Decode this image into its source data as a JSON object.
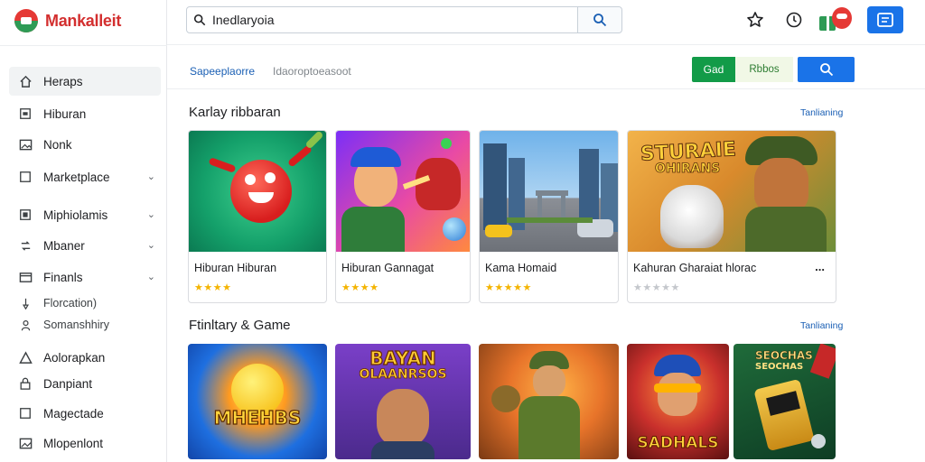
{
  "brand": {
    "name": "Mankalleit"
  },
  "search": {
    "value": "Inedlaryoia",
    "placeholder": ""
  },
  "sidebar": {
    "items": [
      {
        "label": "Heraps",
        "icon": "home-icon",
        "chevron": false,
        "active": true
      },
      {
        "label": "Hiburan",
        "icon": "square-icon",
        "chevron": false,
        "active": false
      },
      {
        "label": "Nonk",
        "icon": "image-icon",
        "chevron": false,
        "active": false
      },
      {
        "label": "Marketplace",
        "icon": "box-icon",
        "chevron": true,
        "active": false
      },
      {
        "label": "Miphiolamis",
        "icon": "grid-icon",
        "chevron": true,
        "active": false
      },
      {
        "label": "Mbaner",
        "icon": "refresh-icon",
        "chevron": true,
        "active": false
      },
      {
        "label": "Finanls",
        "icon": "card-icon",
        "chevron": true,
        "active": false
      },
      {
        "label": "Florcation)",
        "icon": "pin-icon",
        "chevron": false,
        "active": false
      },
      {
        "label": "Somanshhiry",
        "icon": "person-icon",
        "chevron": false,
        "active": false
      },
      {
        "label": "Aolorapkan",
        "icon": "triangle-icon",
        "chevron": false,
        "active": false
      },
      {
        "label": "Danpiant",
        "icon": "lock-icon",
        "chevron": false,
        "active": false
      },
      {
        "label": "Magectade",
        "icon": "square-icon",
        "chevron": false,
        "active": false
      },
      {
        "label": "Mlopenlont",
        "icon": "image-icon",
        "chevron": false,
        "active": false
      }
    ]
  },
  "subbar": {
    "link": "Sapeeplaorre",
    "hint": "Idaoroptoeasoot",
    "green_button": "Gad",
    "light_button": "Rbbos"
  },
  "sections": [
    {
      "title": "Karlay ribbaran",
      "link": "Tanlianing",
      "cards": [
        {
          "title": "Hiburan Hiburan",
          "rating": 4,
          "thumb": "red-mascot"
        },
        {
          "title": "Hiburan Gannagat",
          "rating": 4,
          "thumb": "fighter-duel"
        },
        {
          "title": "Kama Homaid",
          "rating": 5,
          "thumb": "city-street"
        },
        {
          "title": "Kahuran Gharaiat hlorac",
          "rating": 0,
          "thumb": "dog-wolf",
          "more": "..."
        }
      ]
    },
    {
      "title": "Ftinltary & Game",
      "link": "Tanlianing",
      "tiles": [
        "mhehbs-game",
        "bayan-game",
        "soldier-game",
        "sadhals-game",
        "slot-game"
      ]
    }
  ],
  "thumb_text": {
    "dog_wolf_line1": "STURAIE",
    "dog_wolf_line2": "OHIRANS",
    "tile1": "MHEHBS",
    "tile2_line1": "BAYAN",
    "tile2_line2": "OLAANRSOS",
    "tile4": "SADHALS",
    "tile5_line1": "SEOCHAS",
    "tile5_line2": "SEOCHAS"
  },
  "colors": {
    "accent": "#1a73e8",
    "brand": "#d32f2f",
    "green": "#129b48",
    "star": "#f4b400"
  }
}
